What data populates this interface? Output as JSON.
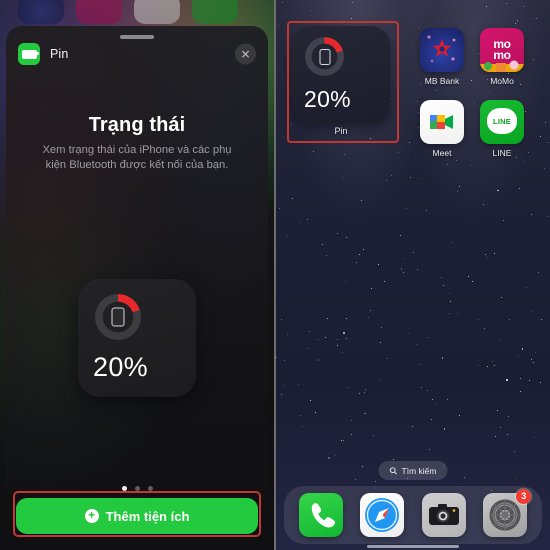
{
  "left_panel": {
    "sheet": {
      "app_icon_name": "battery-icon",
      "app_title": "Pin",
      "close_label": "✕",
      "headline": "Trạng thái",
      "subtitle": "Xem trạng thái của iPhone và các phụ kiện Bluetooth được kết nối của bạn.",
      "preview_widget": {
        "percent_text": "20%",
        "ring_percent": 20,
        "ring_color": "#e8292b",
        "track_color": "#2e2e33"
      },
      "page_dots": {
        "total": 3,
        "active_index": 0
      },
      "add_button": {
        "label": "Thêm tiện ích",
        "plus_glyph": "+",
        "color": "#23c93f"
      },
      "highlight_color": "#c0392f"
    },
    "peek_icons": [
      "MB Bank",
      "MoMo",
      "Meet",
      "LINE"
    ]
  },
  "right_panel": {
    "widget": {
      "percent_text": "20%",
      "ring_percent": 20,
      "label": "Pin",
      "highlight_color": "#c0392f"
    },
    "apps": [
      {
        "name": "MB Bank",
        "icon": "mbbank-icon"
      },
      {
        "name": "MoMo",
        "icon": "momo-icon",
        "glyph_top": "mo",
        "glyph_bottom": "mo"
      },
      {
        "name": "Meet",
        "icon": "meet-icon"
      },
      {
        "name": "LINE",
        "icon": "line-icon",
        "bubble_text": "LINE"
      }
    ],
    "search": {
      "label": "Tìm kiếm",
      "icon": "search-icon"
    },
    "dock": [
      {
        "name": "Phone",
        "icon": "phone-icon",
        "badge": ""
      },
      {
        "name": "Safari",
        "icon": "safari-icon",
        "badge": ""
      },
      {
        "name": "Camera",
        "icon": "camera-icon",
        "badge": ""
      },
      {
        "name": "Settings",
        "icon": "gear-icon",
        "badge": "3"
      }
    ]
  }
}
